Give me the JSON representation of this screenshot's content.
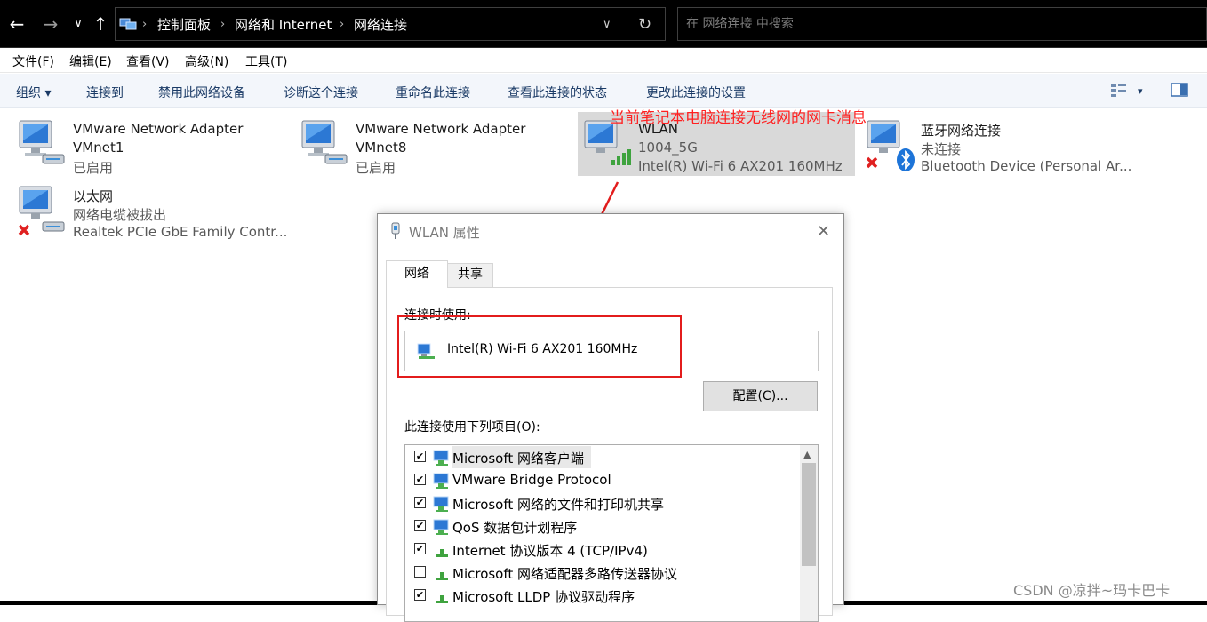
{
  "address_bar": {
    "nav_back": "←",
    "nav_forward": "→",
    "nav_recent": "∨",
    "nav_up": "↑",
    "breadcrumbs": [
      "控制面板",
      "网络和 Internet",
      "网络连接"
    ],
    "separator": "›",
    "dropdown": "∨",
    "refresh": "↻",
    "search_placeholder": "在 网络连接 中搜索"
  },
  "menu": {
    "items": [
      "文件(F)",
      "编辑(E)",
      "查看(V)",
      "高级(N)",
      "工具(T)"
    ]
  },
  "command_bar": {
    "items": [
      "组织 ▾",
      "连接到",
      "禁用此网络设备",
      "诊断这个连接",
      "重命名此连接",
      "查看此连接的状态",
      "更改此连接的设置"
    ],
    "view_dropdown": "▾"
  },
  "adapters": [
    {
      "name": "VMware Network Adapter VMnet1",
      "name_line1": "VMware Network Adapter",
      "name_line2": "VMnet1",
      "status": "已启用",
      "icon": "network-adapter-icon"
    },
    {
      "name": "VMware Network Adapter VMnet8",
      "name_line1": "VMware Network Adapter",
      "name_line2": "VMnet8",
      "status": "已启用",
      "icon": "network-adapter-icon"
    },
    {
      "name": "WLAN",
      "network": "1004_5G",
      "device": "Intel(R) Wi-Fi 6 AX201 160MHz",
      "icon": "wifi-adapter-icon",
      "selected": true
    },
    {
      "name": "蓝牙网络连接",
      "status": "未连接",
      "device": "Bluetooth Device (Personal Ar...",
      "icon": "bluetooth-adapter-icon"
    },
    {
      "name": "以太网",
      "status": "网络电缆被拔出",
      "device": "Realtek PCIe GbE Family Contr...",
      "icon": "ethernet-adapter-icon"
    }
  ],
  "annotation": "当前笔记本电脑连接无线网的网卡消息",
  "dialog": {
    "title": "WLAN 属性",
    "close": "✕",
    "tabs": [
      "网络",
      "共享"
    ],
    "connect_using_label": "连接时使用:",
    "device": "Intel(R) Wi-Fi 6 AX201 160MHz",
    "configure_button": "配置(C)...",
    "items_label": "此连接使用下列项目(O):",
    "items": [
      {
        "label": "Microsoft 网络客户端",
        "checked": true,
        "icon": "network-client-icon"
      },
      {
        "label": "VMware Bridge Protocol",
        "checked": true,
        "icon": "network-client-icon"
      },
      {
        "label": "Microsoft 网络的文件和打印机共享",
        "checked": true,
        "icon": "network-client-icon"
      },
      {
        "label": "QoS 数据包计划程序",
        "checked": true,
        "icon": "network-client-icon"
      },
      {
        "label": "Internet 协议版本 4 (TCP/IPv4)",
        "checked": true,
        "icon": "protocol-icon"
      },
      {
        "label": "Microsoft 网络适配器多路传送器协议",
        "checked": false,
        "icon": "protocol-icon"
      },
      {
        "label": "Microsoft LLDP 协议驱动程序",
        "checked": true,
        "icon": "protocol-icon"
      }
    ],
    "check_mark": "✔",
    "scroll_up": "▲"
  },
  "watermark": "CSDN @凉拌~玛卡巴卡",
  "colors": {
    "annotation": "#ff2020",
    "highlight_box": "#e31c1c",
    "selected_bg": "#d9d9d9",
    "command_text": "#1a3a66"
  }
}
